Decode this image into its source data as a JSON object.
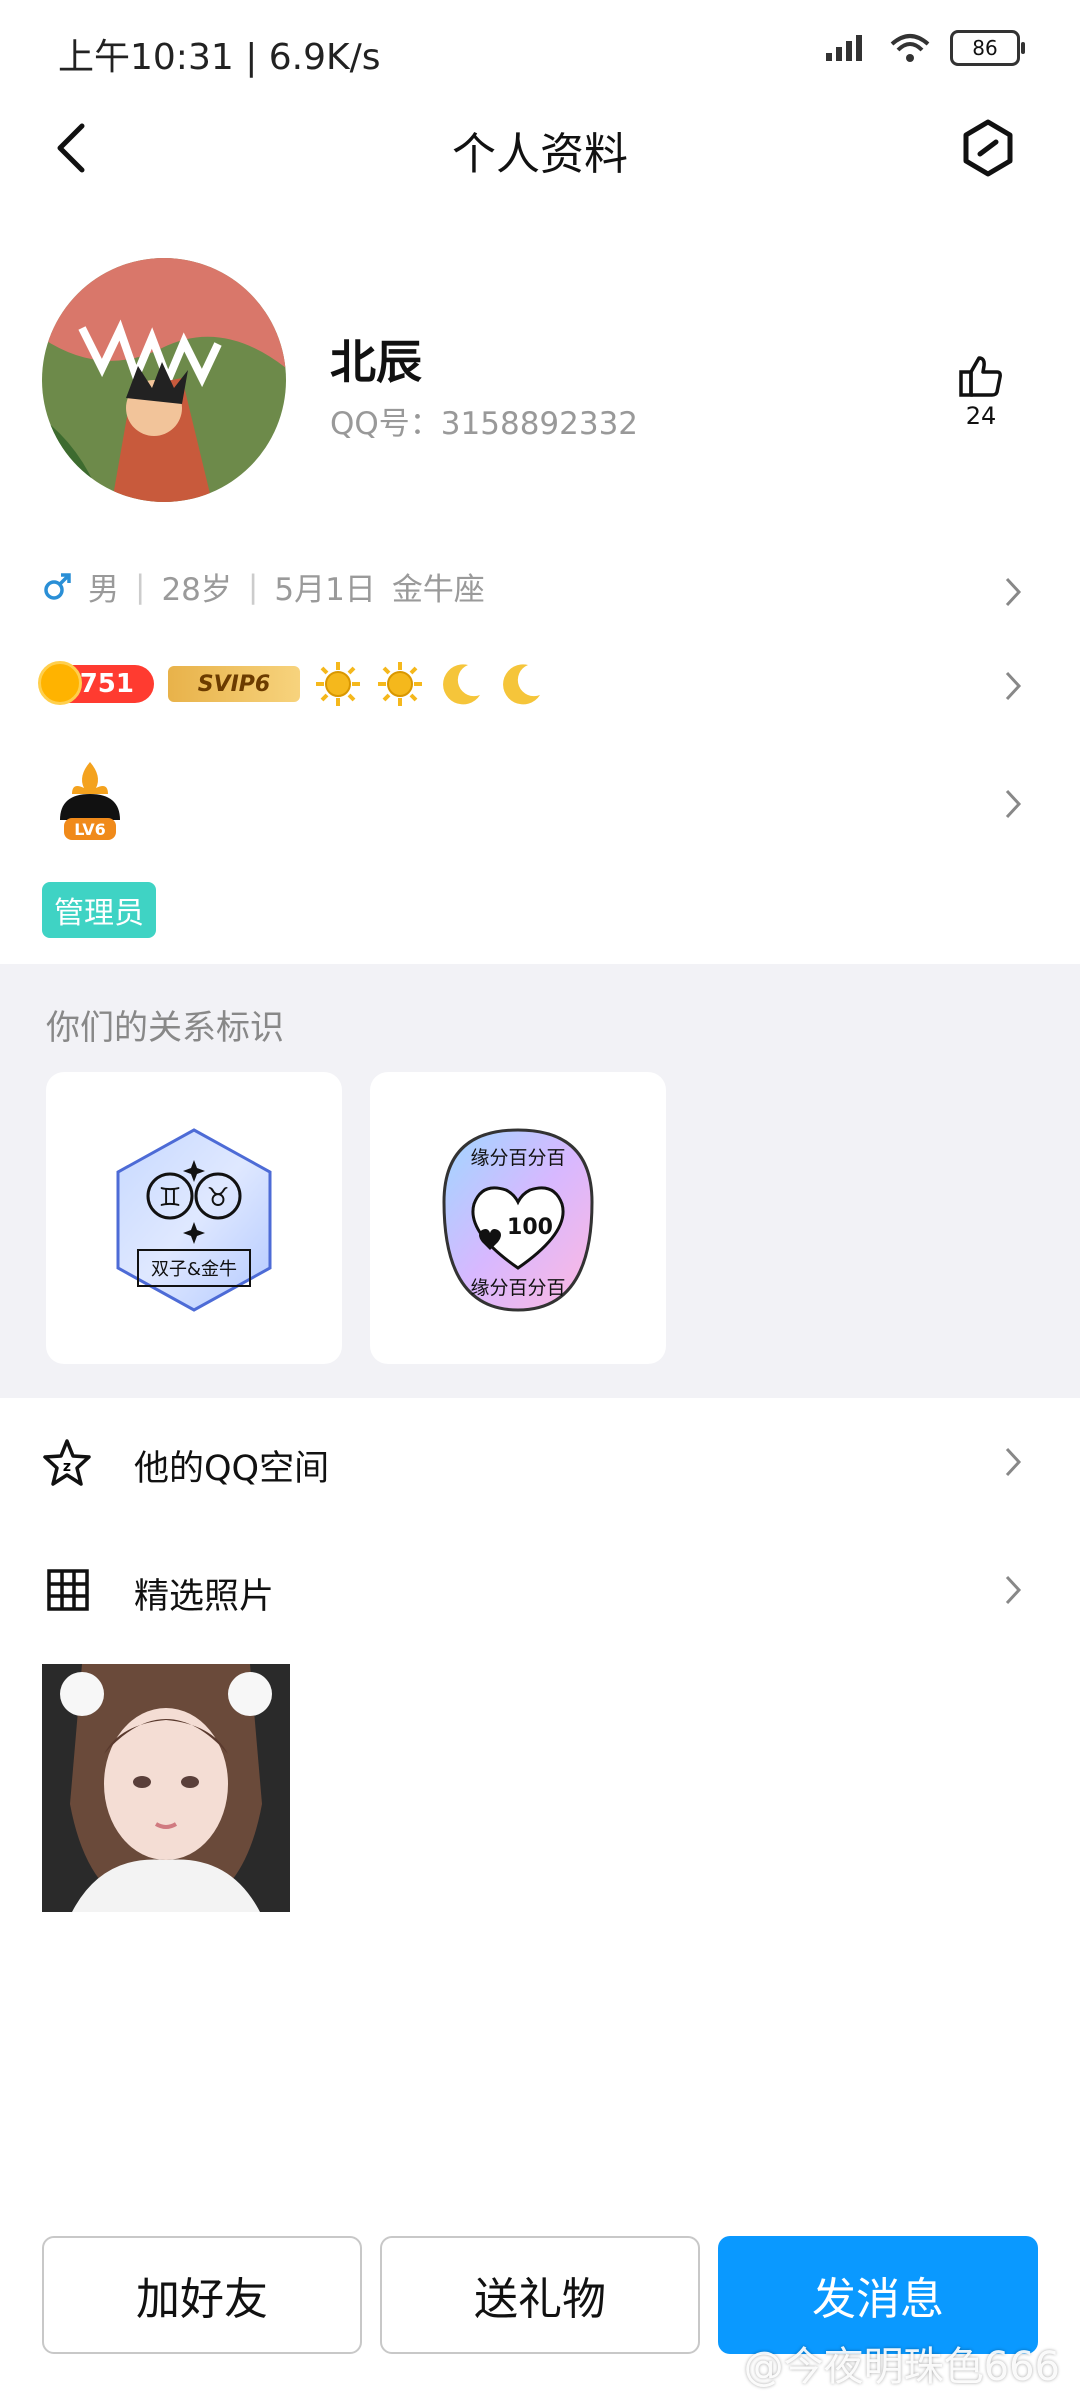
{
  "status_bar": {
    "time": "上午10:31 | 6.9K/s",
    "battery": "86"
  },
  "header": {
    "title": "个人资料"
  },
  "profile": {
    "nickname": "北辰",
    "qq": "QQ号：3158892332",
    "like_count": "24",
    "info": {
      "gender": "男",
      "age": "28岁",
      "birthday": "5月1日",
      "zodiac": "金牛座"
    },
    "coin_level": "751",
    "svip": "SVIP6",
    "lv_badge": "LV6",
    "tag": "管理员"
  },
  "relation": {
    "title": "你们的关系标识",
    "cards": [
      {
        "label": "双子&金牛"
      },
      {
        "label_top": "缘分百分百",
        "label_bottom": "缘分百分百",
        "score": "100"
      }
    ]
  },
  "rows": [
    {
      "label": "他的QQ空间"
    },
    {
      "label": "精选照片"
    }
  ],
  "buttons": {
    "add_friend": "加好友",
    "send_gift": "送礼物",
    "send_message": "发消息"
  },
  "watermark": "@今夜明珠色666",
  "colors": {
    "primary": "#0a99ff",
    "tag": "#3fd3c4",
    "svip": "#e8b24a",
    "relation_bg": "#f2f2f6"
  }
}
